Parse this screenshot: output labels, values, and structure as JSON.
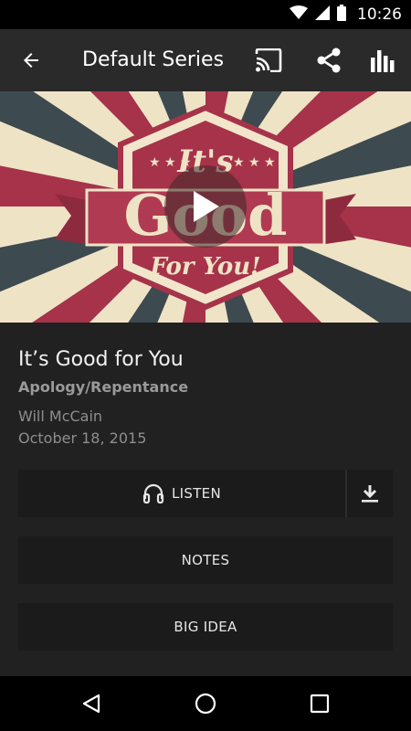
{
  "status_bar": {
    "time": "10:26",
    "icons": [
      "wifi-icon",
      "cell-signal-icon",
      "battery-icon"
    ]
  },
  "toolbar": {
    "title": "Default Series",
    "actions": [
      "cast-icon",
      "share-icon",
      "equalizer-icon"
    ]
  },
  "hero": {
    "artwork_text": {
      "line1": "It's",
      "line2": "Good",
      "line3": "For You!"
    },
    "play_icon": "play-icon"
  },
  "sermon": {
    "title": "It’s Good for You",
    "topic": "Apology/Repentance",
    "speaker": "Will McCain",
    "date": "October 18, 2015"
  },
  "buttons": {
    "listen": "LISTEN",
    "notes": "NOTES",
    "big_idea": "BIG IDEA"
  },
  "colors": {
    "background": "#212121",
    "toolbar": "#2a2a2a",
    "button": "#1b1b1b",
    "art_red": "#a6334a",
    "art_cream": "#efe3c6",
    "art_slate": "#3d4a4f"
  },
  "nav_bar": [
    "back-nav-icon",
    "home-nav-icon",
    "recents-nav-icon"
  ]
}
